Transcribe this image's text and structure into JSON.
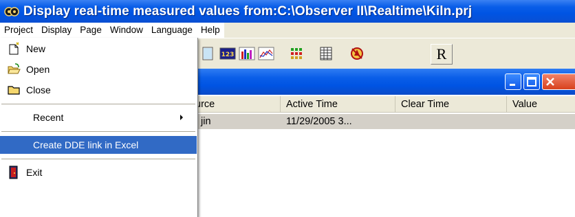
{
  "window": {
    "title": "Display real-time measured values from:C:\\Observer II\\Realtime\\Kiln.prj"
  },
  "menubar": {
    "items": [
      "Project",
      "Display",
      "Page",
      "Window",
      "Language",
      "Help"
    ]
  },
  "toolbar": {
    "icons": [
      "view-icon",
      "numeric-display-icon",
      "bar-chart-icon",
      "line-chart-icon",
      "grid-dots-icon",
      "table-icon",
      "alarm-icon"
    ],
    "r_label": "R"
  },
  "project_menu": {
    "items": {
      "new": "New",
      "open": "Open",
      "close": "Close",
      "recent": "Recent",
      "dde": "Create DDE link in Excel",
      "exit": "Exit"
    }
  },
  "table": {
    "columns": {
      "source": "urce",
      "active_time": "Active Time",
      "clear_time": "Clear Time",
      "value": "Value"
    },
    "rows": [
      {
        "source": "jin",
        "active_time": "11/29/2005 3...",
        "clear_time": "",
        "value": ""
      }
    ]
  },
  "colors": {
    "titlebar": "#0054e3",
    "menu_highlight": "#316ac5",
    "face": "#ece9d8",
    "close_button": "#d8411d"
  }
}
